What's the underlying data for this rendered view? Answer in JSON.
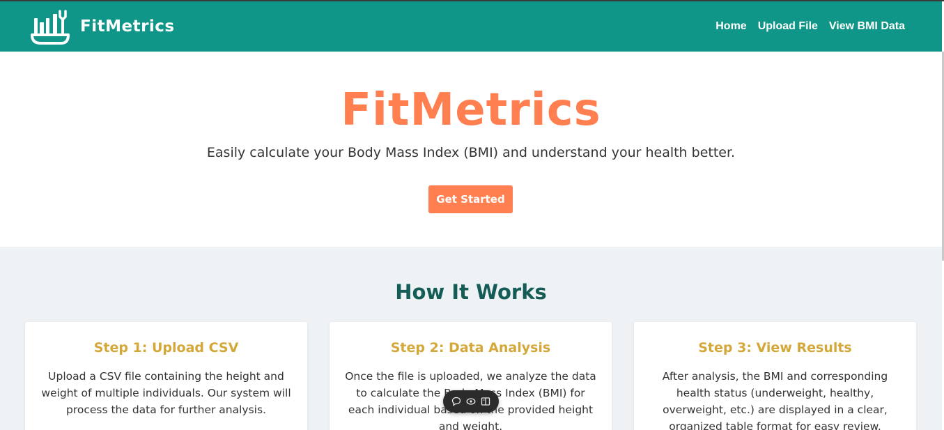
{
  "nav": {
    "brand": "FitMetrics",
    "links": [
      "Home",
      "Upload File",
      "View BMI Data"
    ]
  },
  "hero": {
    "title": "FitMetrics",
    "subtitle": "Easily calculate your Body Mass Index (BMI) and understand your health better.",
    "cta": "Get Started"
  },
  "how": {
    "title": "How It Works",
    "steps": [
      {
        "title": "Step 1: Upload CSV",
        "text": "Upload a CSV file containing the height and weight of multiple individuals. Our system will process the data for further analysis."
      },
      {
        "title": "Step 2: Data Analysis",
        "text": "Once the file is uploaded, we analyze the data to calculate the Body Mass Index (BMI) for each individual based on the provided height and weight."
      },
      {
        "title": "Step 3: View Results",
        "text": "After analysis, the BMI and corresponding health status (underweight, healthy, overweight, etc.) are displayed in a clear, organized table format for easy review."
      }
    ]
  },
  "toolbar": {
    "icons": [
      "comment-icon",
      "eye-icon",
      "book-icon"
    ]
  },
  "colors": {
    "nav_bg": "#0f9688",
    "accent": "#ff7f50",
    "step_title": "#d4a838",
    "section_title": "#145c55",
    "section_bg": "#eef2f5"
  }
}
